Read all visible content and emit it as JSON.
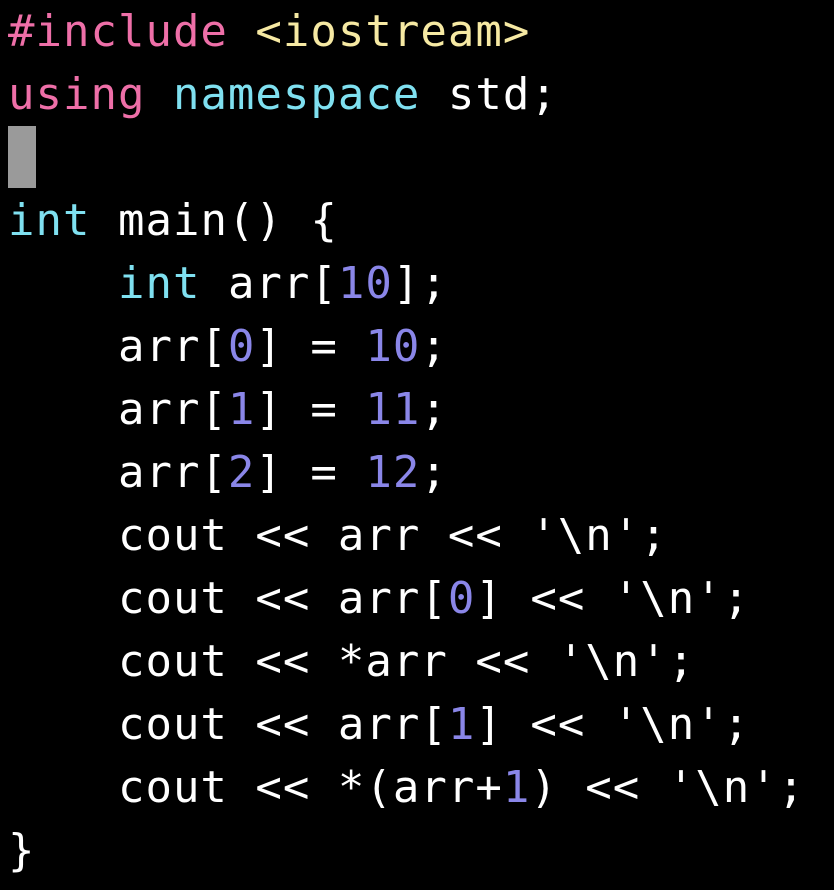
{
  "editor": {
    "colors": {
      "background": "#000000",
      "preprocessor": "#ee6fa8",
      "header": "#f6e9a3",
      "keyword": "#ee6fa8",
      "type": "#7fe0f0",
      "number": "#8a86e8",
      "text": "#ffffff",
      "cursor": "#9a9a9a"
    },
    "lines": [
      [
        {
          "t": "#include",
          "c": "tok-directive"
        },
        {
          "t": " ",
          "c": "tok-plain"
        },
        {
          "t": "<iostream>",
          "c": "tok-header"
        }
      ],
      [
        {
          "t": "using",
          "c": "tok-kw-pink"
        },
        {
          "t": " ",
          "c": "tok-plain"
        },
        {
          "t": "namespace",
          "c": "tok-type"
        },
        {
          "t": " std;",
          "c": "tok-plain"
        }
      ],
      [
        {
          "cursor": true
        }
      ],
      [
        {
          "t": "int",
          "c": "tok-type"
        },
        {
          "t": " main() {",
          "c": "tok-plain"
        }
      ],
      [
        {
          "t": "    ",
          "c": "tok-plain"
        },
        {
          "t": "int",
          "c": "tok-type"
        },
        {
          "t": " arr[",
          "c": "tok-plain"
        },
        {
          "t": "10",
          "c": "tok-num"
        },
        {
          "t": "];",
          "c": "tok-plain"
        }
      ],
      [
        {
          "t": "    arr[",
          "c": "tok-plain"
        },
        {
          "t": "0",
          "c": "tok-num"
        },
        {
          "t": "] = ",
          "c": "tok-plain"
        },
        {
          "t": "10",
          "c": "tok-num"
        },
        {
          "t": ";",
          "c": "tok-plain"
        }
      ],
      [
        {
          "t": "    arr[",
          "c": "tok-plain"
        },
        {
          "t": "1",
          "c": "tok-num"
        },
        {
          "t": "] = ",
          "c": "tok-plain"
        },
        {
          "t": "11",
          "c": "tok-num"
        },
        {
          "t": ";",
          "c": "tok-plain"
        }
      ],
      [
        {
          "t": "    arr[",
          "c": "tok-plain"
        },
        {
          "t": "2",
          "c": "tok-num"
        },
        {
          "t": "] = ",
          "c": "tok-plain"
        },
        {
          "t": "12",
          "c": "tok-num"
        },
        {
          "t": ";",
          "c": "tok-plain"
        }
      ],
      [
        {
          "t": "    cout << arr << '\\n';",
          "c": "tok-plain"
        }
      ],
      [
        {
          "t": "    cout << arr[",
          "c": "tok-plain"
        },
        {
          "t": "0",
          "c": "tok-num"
        },
        {
          "t": "] << '\\n';",
          "c": "tok-plain"
        }
      ],
      [
        {
          "t": "    cout << *arr << '\\n';",
          "c": "tok-plain"
        }
      ],
      [
        {
          "t": "    cout << arr[",
          "c": "tok-plain"
        },
        {
          "t": "1",
          "c": "tok-num"
        },
        {
          "t": "] << '\\n';",
          "c": "tok-plain"
        }
      ],
      [
        {
          "t": "    cout << *(arr+",
          "c": "tok-plain"
        },
        {
          "t": "1",
          "c": "tok-num"
        },
        {
          "t": ") << '\\n';",
          "c": "tok-plain"
        }
      ],
      [
        {
          "t": "}",
          "c": "tok-plain"
        }
      ]
    ]
  }
}
